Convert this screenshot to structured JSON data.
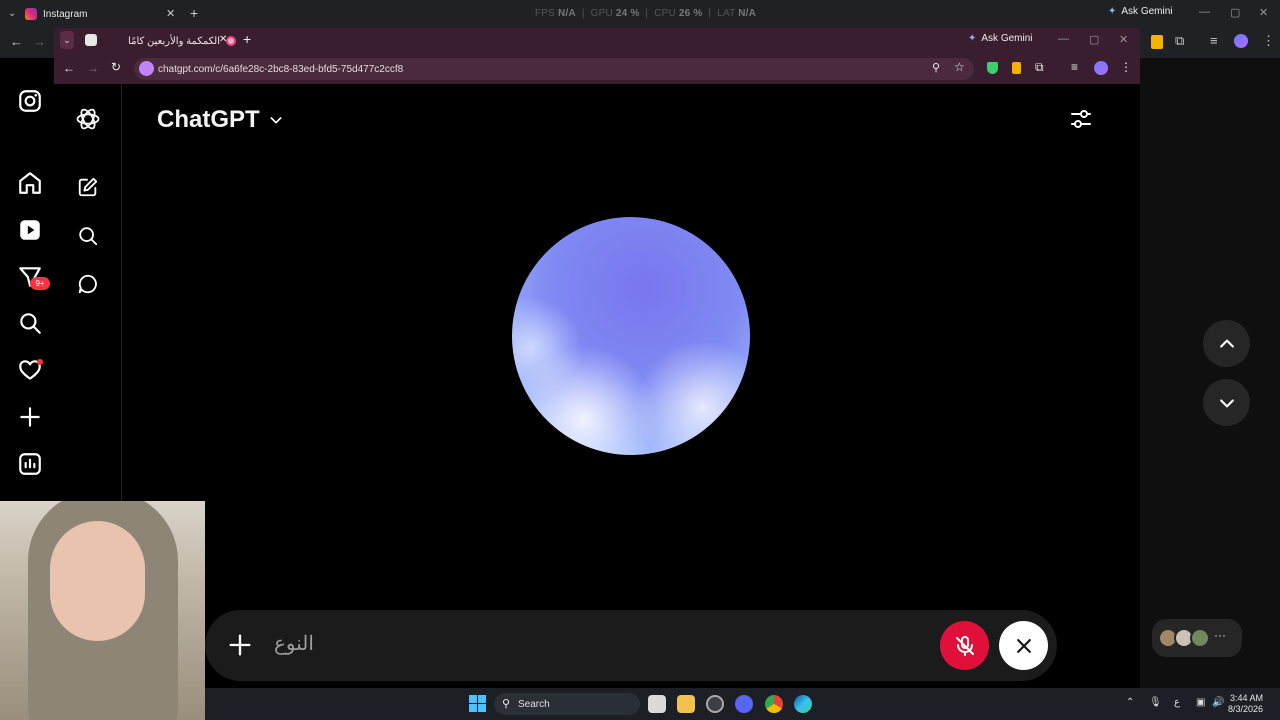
{
  "outer_browser": {
    "tab_title": "Instagram",
    "perf": {
      "fps_label": "FPS",
      "fps": "N/A",
      "gpu_label": "GPU",
      "gpu": "24 %",
      "cpu_label": "CPU",
      "cpu": "26 %",
      "lat_label": "LAT",
      "lat": "N/A"
    },
    "ask_gemini": "Ask Gemini"
  },
  "instagram_sidebar": {
    "messages_badge": "9+",
    "icons": [
      "instagram-logo-icon",
      "home-icon",
      "reels-icon",
      "messages-icon",
      "search-icon",
      "notifications-icon",
      "create-icon",
      "dashboard-icon"
    ]
  },
  "inner_browser": {
    "tab_title": "الكمكمة والأربعين كامًا",
    "url": "chatgpt.com/c/6a6fe28c-2bc8-83ed-bfd5-75d477c2ccf8",
    "ask_gemini": "Ask Gemini"
  },
  "chatgpt": {
    "title": "ChatGPT",
    "input_placeholder": "النوع"
  },
  "taskbar": {
    "search_label": "Search",
    "time": "3:44 AM",
    "date": "8/3/2026",
    "lang": "ع"
  },
  "colors": {
    "mute_red": "#e0103a",
    "orb_blue": "#7a75ee",
    "inner_chrome": "#3a1d2e"
  }
}
